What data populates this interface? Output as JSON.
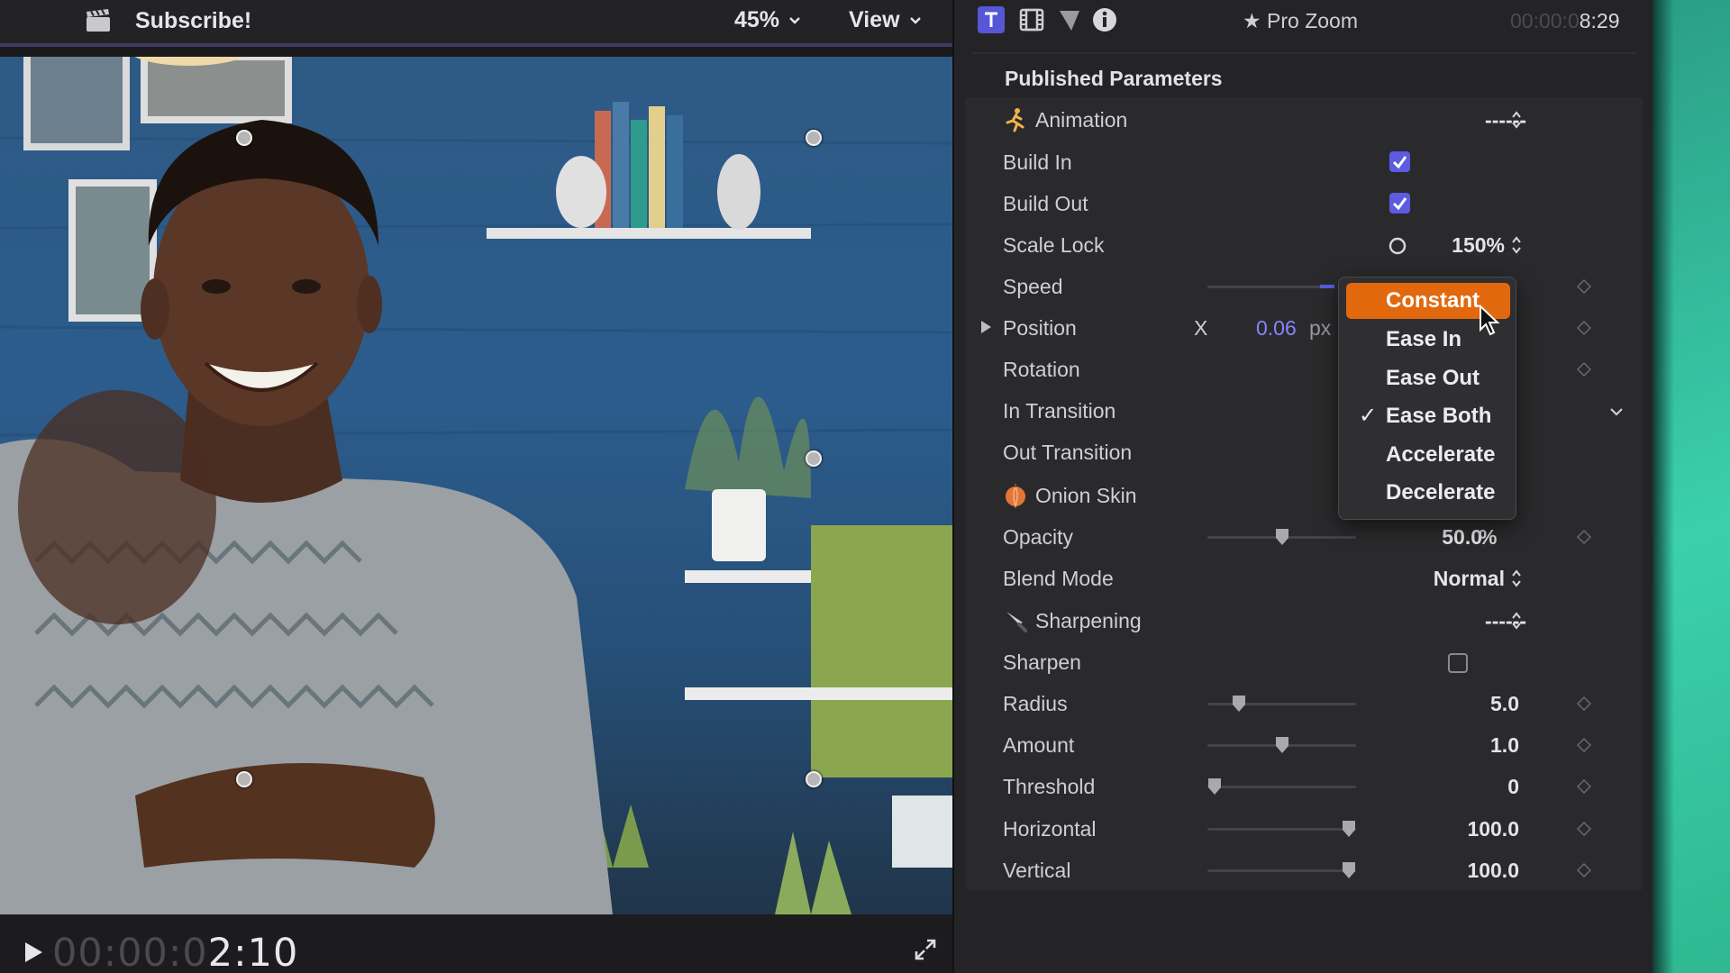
{
  "viewer": {
    "clip_title": "Subscribe!",
    "zoom_value": "45%",
    "view_menu_label": "View",
    "timecode_dim": "00:00:0",
    "timecode_bright": "2:10"
  },
  "inspector": {
    "tabs": [
      {
        "name": "Text",
        "icon": "text-icon",
        "active": true
      },
      {
        "name": "Video",
        "icon": "film-icon",
        "active": false
      },
      {
        "name": "Generator",
        "icon": "filter-icon",
        "active": false
      },
      {
        "name": "Info",
        "icon": "info-icon",
        "active": false
      }
    ],
    "title": "★ Pro Zoom",
    "duration_dim": "00:00:0",
    "duration_bright": "8:29",
    "section_title": "Published Parameters",
    "params": {
      "animation": {
        "label": "Animation",
        "value": "------"
      },
      "build_in": {
        "label": "Build In",
        "checked": true
      },
      "build_out": {
        "label": "Build Out",
        "checked": true
      },
      "scale_lock": {
        "label": "Scale Lock",
        "value": "150%"
      },
      "speed": {
        "label": "Speed"
      },
      "position": {
        "label": "Position",
        "axis": "X",
        "value": "0.06",
        "unit": "px"
      },
      "rotation": {
        "label": "Rotation"
      },
      "in_transition": {
        "label": "In Transition"
      },
      "out_transition": {
        "label": "Out Transition"
      },
      "onion_skin": {
        "label": "Onion Skin"
      },
      "opacity": {
        "label": "Opacity",
        "value": "50.0",
        "unit": "%",
        "level": 0.5
      },
      "blend_mode": {
        "label": "Blend Mode",
        "value": "Normal"
      },
      "sharpening": {
        "label": "Sharpening",
        "value": "------"
      },
      "sharpen": {
        "label": "Sharpen",
        "checked": false
      },
      "radius": {
        "label": "Radius",
        "value": "5.0",
        "level": 0.18
      },
      "amount": {
        "label": "Amount",
        "value": "1.0",
        "level": 0.5
      },
      "threshold": {
        "label": "Threshold",
        "value": "0",
        "level": 0.0
      },
      "horizontal": {
        "label": "Horizontal",
        "value": "100.0",
        "level": 1.0
      },
      "vertical": {
        "label": "Vertical",
        "value": "100.0",
        "level": 1.0
      }
    }
  },
  "speed_menu": {
    "items": [
      "Constant",
      "Ease In",
      "Ease Out",
      "Ease Both",
      "Accelerate",
      "Decelerate"
    ],
    "highlighted": "Constant",
    "checked": "Ease Both",
    "check_glyph": "✓"
  },
  "colors": {
    "accent": "#5b5ce0",
    "menu_highlight": "#e2680e",
    "position_value": "#8585ff",
    "desktop": "#3bd0ac"
  }
}
